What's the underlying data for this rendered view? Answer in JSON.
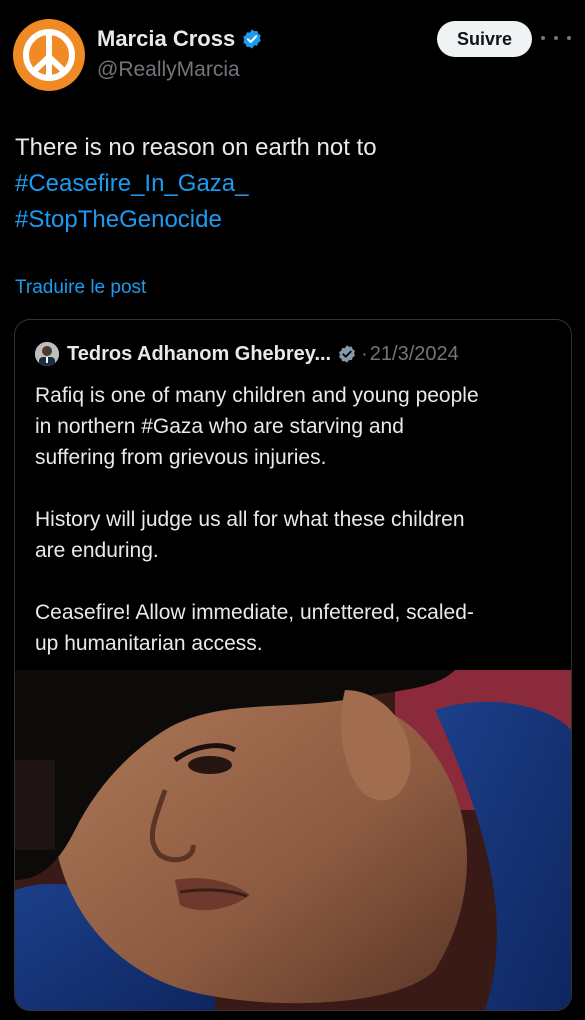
{
  "post": {
    "author_name": "Marcia Cross",
    "author_handle": "@ReallyMarcia",
    "follow_label": "Suivre",
    "text_line1": "There is no reason on earth not to",
    "hashtag1": "#Ceasefire_In_Gaza_",
    "hashtag2": "#StopTheGenocide",
    "translate_label": "Traduire le post",
    "avatar_icon": "peace-sign-icon",
    "avatar_color": "#f08a24"
  },
  "quote": {
    "author_name": "Tedros Adhanom Ghebrey...",
    "separator": "·",
    "date": "21/3/2024",
    "p1_l1": "Rafiq is one of many children and young people",
    "p1_l2": "in northern #Gaza who are starving and",
    "p1_l3": "suffering from grievous injuries.",
    "p2_l1": "History will judge us all for what these children",
    "p2_l2": "are enduring.",
    "p3_l1": "Ceasefire! Allow immediate, unfettered, scaled-",
    "p3_l2": "up humanitarian access."
  },
  "colors": {
    "background": "#000000",
    "accent": "#1d9bf0",
    "text": "#e7e9ea",
    "muted": "#71767b"
  }
}
